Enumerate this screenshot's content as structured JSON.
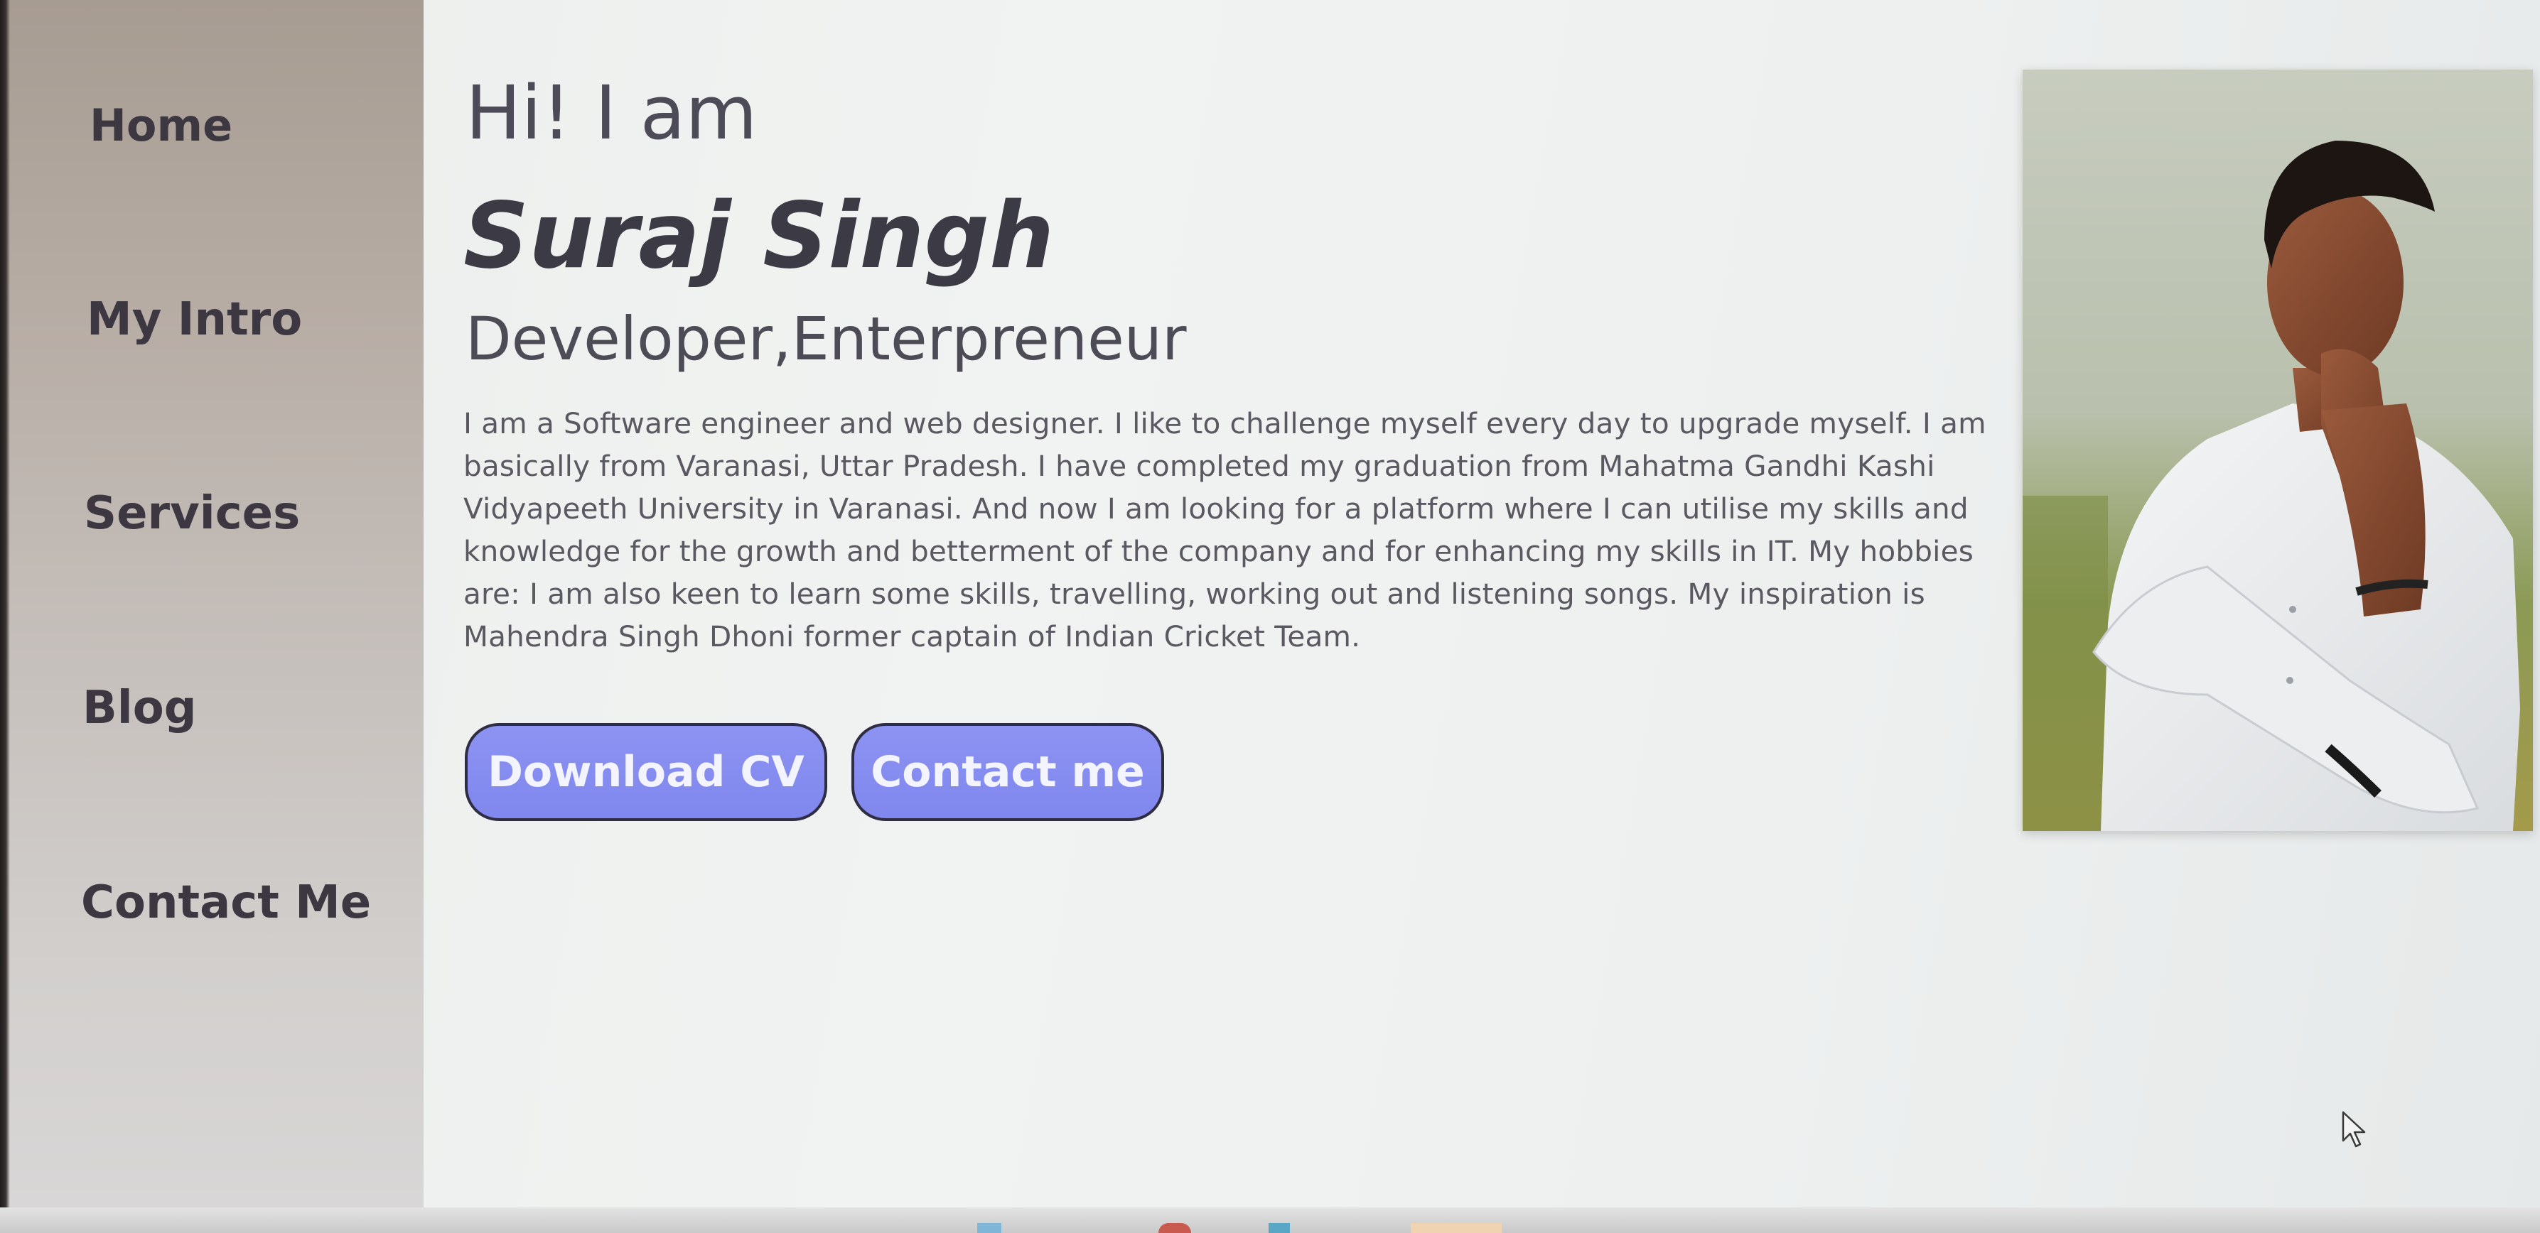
{
  "sidebar": {
    "items": [
      {
        "label": "Home"
      },
      {
        "label": "My Intro"
      },
      {
        "label": "Services"
      },
      {
        "label": "Blog"
      },
      {
        "label": "Contact Me"
      }
    ]
  },
  "hero": {
    "greeting": "Hi! I am",
    "name": "Suraj Singh",
    "roles": "Developer,Enterpreneur",
    "bio": "I am a Software engineer and web designer. I like to challenge myself every day to upgrade myself. I am basically from Varanasi, Uttar Pradesh. I have completed my graduation from Mahatma Gandhi Kashi Vidyapeeth University in Varanasi. And now I am looking for a platform where I can utilise my skills and knowledge for the growth and betterment of the company and for enhancing my skills in IT. My hobbies are: I am also keen to learn some skills, travelling, working out and listening songs. My inspiration is Mahendra Singh Dhoni former captain of Indian Cricket Team."
  },
  "buttons": {
    "download_cv": "Download CV",
    "contact_me": "Contact me"
  },
  "colors": {
    "button_fill": "#8087ee",
    "button_border": "#2f2d44",
    "sidebar_top": "#a79c92",
    "text_dark": "#3b3a45"
  },
  "icons": {
    "cursor": "mouse-pointer-icon",
    "photo": "profile-photo"
  }
}
